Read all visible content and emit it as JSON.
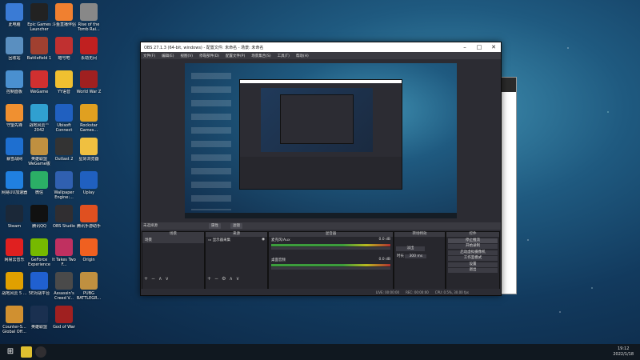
{
  "desktop": {
    "icons": [
      {
        "label": "此电脑",
        "color": "#3a7bd5"
      },
      {
        "label": "Epic Games Launcher",
        "color": "#222"
      },
      {
        "label": "斗鱼直播伴侣",
        "color": "#f08030"
      },
      {
        "label": "Rise of the Tomb Rai...",
        "color": "#888"
      },
      {
        "label": "回收站",
        "color": "#5a8fc0"
      },
      {
        "label": "Battlefield 1",
        "color": "#a04030"
      },
      {
        "label": "暗号吧",
        "color": "#c03030"
      },
      {
        "label": "永劫无间",
        "color": "#c02020"
      },
      {
        "label": "控制面板",
        "color": "#4a90d0"
      },
      {
        "label": "WeGame",
        "color": "#d03030"
      },
      {
        "label": "YY语音",
        "color": "#f0c030"
      },
      {
        "label": "World War Z",
        "color": "#a02020"
      },
      {
        "label": "守望先锋",
        "color": "#f09030"
      },
      {
        "label": "战地风云™ 2042",
        "color": "#30a0d0"
      },
      {
        "label": "Ubisoft Connect",
        "color": "#2060c0"
      },
      {
        "label": "Rockstar Games...",
        "color": "#e0a020"
      },
      {
        "label": "暴雪战网",
        "color": "#1e6fd0"
      },
      {
        "label": "英雄联盟 WeGame版",
        "color": "#c09040"
      },
      {
        "label": "Outlast 2",
        "color": "#333"
      },
      {
        "label": "星际浏览器",
        "color": "#f0c040"
      },
      {
        "label": "网易UU加速器",
        "color": "#2080e0"
      },
      {
        "label": "微信",
        "color": "#2bae66"
      },
      {
        "label": "Wallpaper Engine:...",
        "color": "#3060b0"
      },
      {
        "label": "Uplay",
        "color": "#2060c0"
      },
      {
        "label": "Steam",
        "color": "#1b2838"
      },
      {
        "label": "腾讯QQ",
        "color": "#111"
      },
      {
        "label": "OBS Studio",
        "color": "#302e31"
      },
      {
        "label": "腾讯手游助手",
        "color": "#e05020"
      },
      {
        "label": "网易云音乐",
        "color": "#e02020"
      },
      {
        "label": "GeForce Experience",
        "color": "#76b900"
      },
      {
        "label": "It Takes Two F...",
        "color": "#c03060"
      },
      {
        "label": "Origin",
        "color": "#f06020"
      },
      {
        "label": "战地风云 5 ...",
        "color": "#e0a000"
      },
      {
        "label": "5E对战平台",
        "color": "#2060d0"
      },
      {
        "label": "Assassin's Creed V...",
        "color": "#4a4a4a"
      },
      {
        "label": "PUBG BATTLEGR...",
        "color": "#c09040"
      },
      {
        "label": "Counter-S... Global Off...",
        "color": "#d09030"
      },
      {
        "label": "英雄联盟",
        "color": "#1a3050"
      },
      {
        "label": "God of War",
        "color": "#a02020"
      }
    ]
  },
  "obs": {
    "title": "OBS 27.1.3 (64-bit, windows) - 配置文件: 未命名 - 场景: 未命名",
    "menu": [
      "文件(F)",
      "编辑(E)",
      "视图(V)",
      "停靠部件(D)",
      "配置文件(P)",
      "场景集合(S)",
      "工具(T)",
      "帮助(H)"
    ],
    "toolbar": {
      "no_source": "未选择源",
      "properties": "属性",
      "filters": "滤镜"
    },
    "docks": {
      "scenes": {
        "title": "场景",
        "items": [
          "场景"
        ]
      },
      "sources": {
        "title": "来源",
        "items": [
          "显示器采集"
        ]
      },
      "mixer": {
        "title": "混音器",
        "tracks": [
          {
            "name": "麦克风/Aux",
            "db": "0.0 dB"
          },
          {
            "name": "桌面音频",
            "db": "0.0 dB"
          }
        ]
      },
      "transitions": {
        "title": "转场特效",
        "type": "淡出",
        "duration_label": "时长",
        "duration": "300 ms"
      },
      "controls": {
        "title": "控件",
        "buttons": [
          "停止推流",
          "开始录制",
          "启动虚拟摄像机",
          "工作室模式",
          "设置",
          "退出"
        ]
      }
    },
    "status": {
      "live": "LIVE: 00:00:00",
      "rec": "REC: 00:00:00",
      "cpu": "CPU: 0.5%, 30.00 fps"
    }
  },
  "taskbar": {
    "time": "19:12",
    "date": "2022/1/18"
  }
}
